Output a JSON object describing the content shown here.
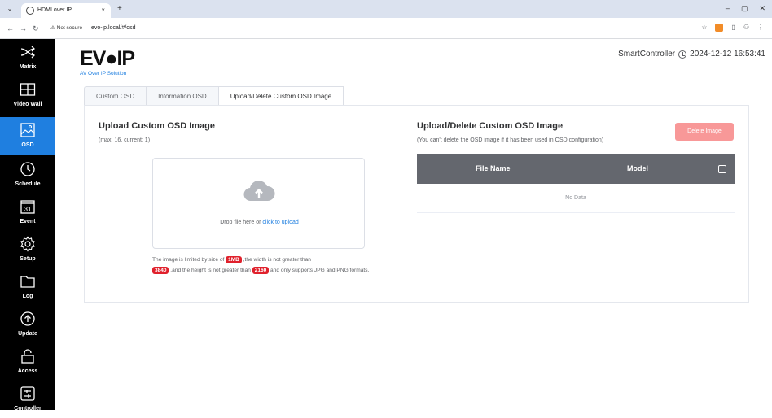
{
  "browser": {
    "tab_title": "HDMI over IP",
    "tab_close": "×",
    "new_tab": "+",
    "tab_menu": "⌄",
    "security_label": "⚠ Not secure",
    "url": "evo-ip.local/#/osd",
    "window_controls": [
      "–",
      "▢",
      "✕"
    ]
  },
  "sidebar": {
    "items": [
      {
        "label": "Matrix",
        "icon": "shuffle-icon"
      },
      {
        "label": "Video Wall",
        "icon": "video-wall-icon"
      },
      {
        "label": "OSD",
        "icon": "image-icon",
        "active": true
      },
      {
        "label": "Schedule",
        "icon": "clock-icon"
      },
      {
        "label": "Event",
        "icon": "calendar-icon",
        "icon_text": "31"
      },
      {
        "label": "Setup",
        "icon": "gear-icon"
      },
      {
        "label": "Log",
        "icon": "folder-icon"
      },
      {
        "label": "Update",
        "icon": "upload-circle-icon"
      },
      {
        "label": "Access",
        "icon": "lock-icon"
      },
      {
        "label": "Controller",
        "icon": "controller-icon"
      }
    ]
  },
  "header": {
    "logo_text": "EV●IP",
    "logo_sub": "AV Over IP Solution",
    "controller_name": "SmartController",
    "datetime": "2024-12-12 16:53:41"
  },
  "tabs": [
    {
      "label": "Custom OSD"
    },
    {
      "label": "Information OSD"
    },
    {
      "label": "Upload/Delete Custom OSD Image",
      "active": true
    }
  ],
  "upload": {
    "title": "Upload Custom OSD Image",
    "subtitle": "(max: 16, current: 1)",
    "drop_text": "Drop file here or ",
    "drop_link": "click to upload",
    "note_1": "The image is limited by size of ",
    "size_tag": "1MB",
    "note_2": " ,the width is not greater than ",
    "width_tag": "3840",
    "note_3": " ,and the height is not greater than ",
    "height_tag": "2160",
    "note_4": " and only supports JPG and PNG formats."
  },
  "manage": {
    "title": "Upload/Delete Custom OSD Image",
    "subtitle": "(You can't delete the OSD image if it has been used in OSD configuration)",
    "delete_button": "Delete Image",
    "columns": [
      "File Name",
      "Model"
    ],
    "empty_text": "No Data"
  },
  "colors": {
    "accent": "#1f7fe0",
    "sidebar_bg": "#000000",
    "table_header": "#64676e",
    "tag_red": "#e0212c",
    "danger_disabled": "#f89898"
  }
}
